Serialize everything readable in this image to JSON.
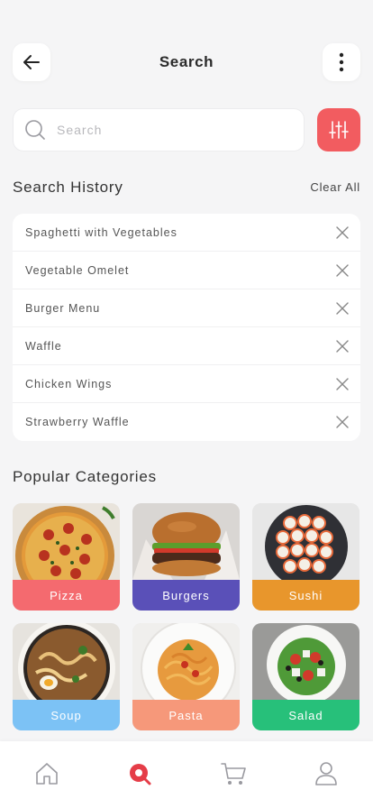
{
  "header": {
    "title": "Search"
  },
  "search": {
    "placeholder": "Search"
  },
  "history": {
    "title": "Search History",
    "clear_label": "Clear All",
    "items": [
      "Spaghetti with Vegetables",
      "Vegetable Omelet",
      "Burger Menu",
      "Waffle",
      "Chicken Wings",
      "Strawberry Waffle"
    ]
  },
  "popular": {
    "title": "Popular Categories",
    "categories": [
      {
        "label": "Pizza",
        "color": "#f46a6f",
        "icon": "pizza-image"
      },
      {
        "label": "Burgers",
        "color": "#5a50b8",
        "icon": "burger-image"
      },
      {
        "label": "Sushi",
        "color": "#e8962c",
        "icon": "sushi-image"
      },
      {
        "label": "Soup",
        "color": "#7cc2f5",
        "icon": "soup-image"
      },
      {
        "label": "Pasta",
        "color": "#f6987a",
        "icon": "pasta-image"
      },
      {
        "label": "Salad",
        "color": "#27c07a",
        "icon": "salad-image"
      }
    ]
  },
  "nav": {
    "items": [
      {
        "icon": "home-icon",
        "active": false
      },
      {
        "icon": "search-icon",
        "active": true
      },
      {
        "icon": "cart-icon",
        "active": false
      },
      {
        "icon": "profile-icon",
        "active": false
      }
    ]
  },
  "colors": {
    "accent": "#f25c60",
    "background": "#f5f5f6"
  }
}
